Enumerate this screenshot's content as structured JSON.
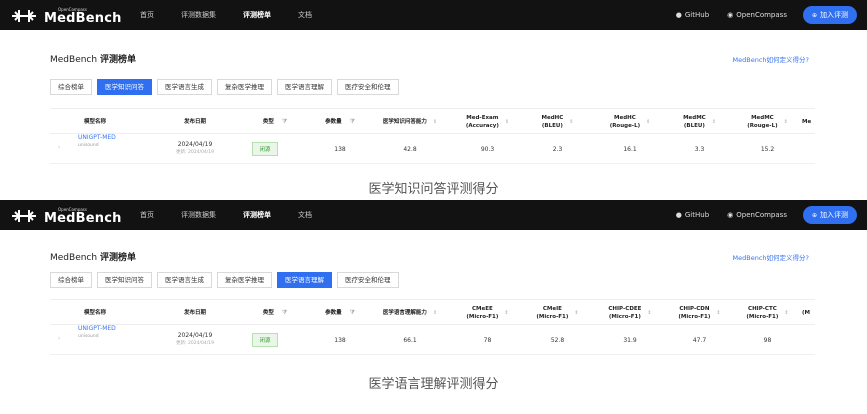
{
  "navbar": {
    "logo_small": "OpenCompass",
    "logo_big": "MedBench",
    "links": [
      "首页",
      "评测数据集",
      "评测榜单",
      "文档"
    ],
    "active_link": "评测榜单",
    "github": "GitHub",
    "opencompass": "OpenCompass",
    "join": "加入评测"
  },
  "panels": [
    {
      "board_title_prefix": "MedBench ",
      "board_title_bold": "评测榜单",
      "custom_link": "MedBench如何定义得分?",
      "tabs": [
        "综合榜单",
        "医学知识问答",
        "医学语言生成",
        "复杂医学推理",
        "医学语言理解",
        "医疗安全和伦理"
      ],
      "active_tab": "医学知识问答",
      "columns": [
        "模型名称",
        "发布日期",
        "类型",
        "",
        "参数量",
        "",
        "医学知识问答能力",
        "Med-Exam\n(Accuracy)",
        "MedHC\n(BLEU)",
        "MedHC\n(Rouge-L)",
        "MedMC\n(BLEU)",
        "MedMC\n(Rouge-L)",
        "Me"
      ],
      "row": {
        "model": "UNIGPT-MED",
        "org": "unisound",
        "date": "2024/04/19",
        "updated": "更新: 2024/04/19",
        "type": "闭源",
        "params": "138",
        "score": "42.8",
        "values": [
          "90.3",
          "2.3",
          "16.1",
          "3.3",
          "15.2"
        ]
      },
      "caption": "医学知识问答评测得分"
    },
    {
      "board_title_prefix": "MedBench ",
      "board_title_bold": "评测榜单",
      "custom_link": "MedBench如何定义得分?",
      "tabs": [
        "综合榜单",
        "医学知识问答",
        "医学语言生成",
        "复杂医学推理",
        "医学语言理解",
        "医疗安全和伦理"
      ],
      "active_tab": "医学语言理解",
      "columns": [
        "模型名称",
        "发布日期",
        "类型",
        "",
        "参数量",
        "",
        "医学语言理解能力",
        "CMeEE\n(Micro-F1)",
        "CMeIE\n(Micro-F1)",
        "CHIP-CDEE\n(Micro-F1)",
        "CHIP-CDN\n(Micro-F1)",
        "CHIP-CTC\n(Micro-F1)",
        "(M"
      ],
      "row": {
        "model": "UNIGPT-MED",
        "org": "unisound",
        "date": "2024/04/19",
        "updated": "更新: 2024/04/19",
        "type": "闭源",
        "params": "138",
        "score": "66.1",
        "values": [
          "78",
          "52.8",
          "31.9",
          "47.7",
          "98"
        ]
      },
      "caption": "医学语言理解评测得分"
    }
  ],
  "icons": {
    "github": "github-icon",
    "opencompass": "opencompass-icon",
    "join": "plus-circle-icon",
    "sort": "sort-icon",
    "filter": "filter-icon"
  },
  "colors": {
    "navbar_bg": "#121212",
    "accent": "#2f6ff0",
    "link": "#3a74ee",
    "tag_green": "#3c9a3c"
  }
}
